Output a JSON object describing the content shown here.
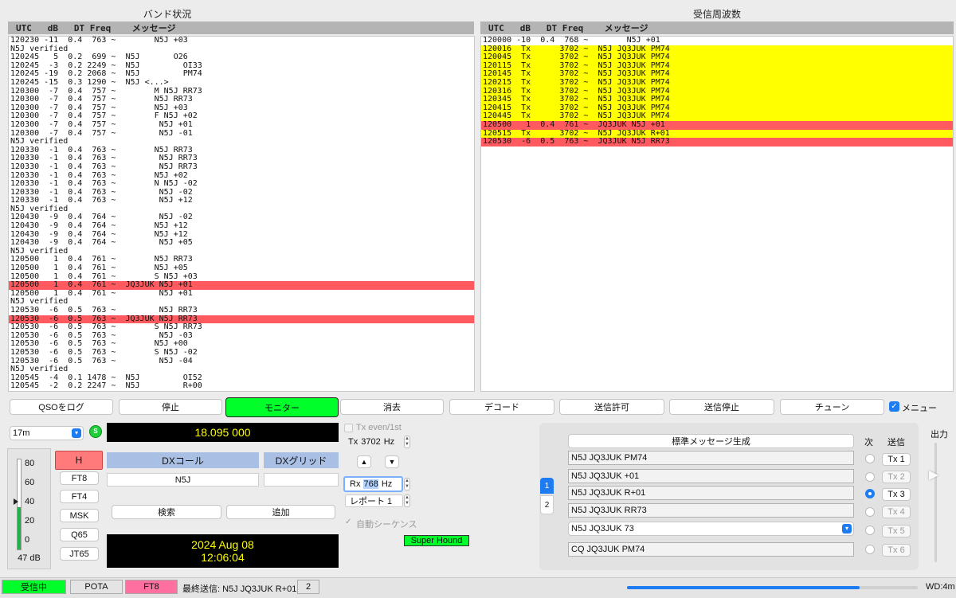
{
  "band_panel": {
    "title": "バンド状況",
    "header": "UTC   dB   DT Freq    メッセージ",
    "lines": [
      {
        "text": "120230 -11  0.4  763 ~        N5J +03",
        "hl": ""
      },
      {
        "text": "N5J verified",
        "hl": ""
      },
      {
        "text": "120245   5  0.2  699 ~  N5J       O26",
        "hl": ""
      },
      {
        "text": "120245  -3  0.2 2249 ~  N5J         OI33",
        "hl": ""
      },
      {
        "text": "120245 -19  0.2 2068 ~  N5J         PM74",
        "hl": ""
      },
      {
        "text": "120245 -15  0.3 1290 ~  N5J <...>",
        "hl": ""
      },
      {
        "text": "120300  -7  0.4  757 ~        M N5J RR73",
        "hl": ""
      },
      {
        "text": "120300  -7  0.4  757 ~        N5J RR73",
        "hl": ""
      },
      {
        "text": "120300  -7  0.4  757 ~        N5J +03",
        "hl": ""
      },
      {
        "text": "120300  -7  0.4  757 ~        F N5J +02",
        "hl": ""
      },
      {
        "text": "120300  -7  0.4  757 ~         N5J +01",
        "hl": ""
      },
      {
        "text": "120300  -7  0.4  757 ~         N5J -01",
        "hl": ""
      },
      {
        "text": "N5J verified",
        "hl": ""
      },
      {
        "text": "120330  -1  0.4  763 ~        N5J RR73",
        "hl": ""
      },
      {
        "text": "120330  -1  0.4  763 ~         N5J RR73",
        "hl": ""
      },
      {
        "text": "120330  -1  0.4  763 ~         N5J RR73",
        "hl": ""
      },
      {
        "text": "120330  -1  0.4  763 ~        N5J +02",
        "hl": ""
      },
      {
        "text": "120330  -1  0.4  763 ~        N N5J -02",
        "hl": ""
      },
      {
        "text": "120330  -1  0.4  763 ~         N5J -02",
        "hl": ""
      },
      {
        "text": "120330  -1  0.4  763 ~         N5J +12",
        "hl": ""
      },
      {
        "text": "N5J verified",
        "hl": ""
      },
      {
        "text": "120430  -9  0.4  764 ~         N5J -02",
        "hl": ""
      },
      {
        "text": "120430  -9  0.4  764 ~        N5J +12",
        "hl": ""
      },
      {
        "text": "120430  -9  0.4  764 ~        N5J +12",
        "hl": ""
      },
      {
        "text": "120430  -9  0.4  764 ~         N5J +05",
        "hl": ""
      },
      {
        "text": "N5J verified",
        "hl": ""
      },
      {
        "text": "120500   1  0.4  761 ~        N5J RR73",
        "hl": ""
      },
      {
        "text": "120500   1  0.4  761 ~        N5J +05",
        "hl": ""
      },
      {
        "text": "120500   1  0.4  761 ~        S N5J +03",
        "hl": ""
      },
      {
        "text": "120500   1  0.4  761 ~  JQ3JUK N5J +01",
        "hl": "red"
      },
      {
        "text": "120500   1  0.4  761 ~         N5J +01",
        "hl": ""
      },
      {
        "text": "N5J verified",
        "hl": ""
      },
      {
        "text": "120530  -6  0.5  763 ~         N5J RR73",
        "hl": ""
      },
      {
        "text": "120530  -6  0.5  763 ~  JQ3JUK N5J RR73",
        "hl": "red"
      },
      {
        "text": "120530  -6  0.5  763 ~        S N5J RR73",
        "hl": ""
      },
      {
        "text": "120530  -6  0.5  763 ~         N5J -03",
        "hl": ""
      },
      {
        "text": "120530  -6  0.5  763 ~        N5J +00",
        "hl": ""
      },
      {
        "text": "120530  -6  0.5  763 ~        S N5J -02",
        "hl": ""
      },
      {
        "text": "120530  -6  0.5  763 ~         N5J -04",
        "hl": ""
      },
      {
        "text": "N5J verified",
        "hl": ""
      },
      {
        "text": "120545  -4  0.1 1478 ~  N5J         OI52",
        "hl": ""
      },
      {
        "text": "120545  -2  0.2 2247 ~  N5J         R+00",
        "hl": ""
      }
    ]
  },
  "rx_panel": {
    "title": "受信周波数",
    "header": "UTC   dB   DT Freq    メッセージ",
    "lines": [
      {
        "text": "120000 -10  0.4  768 ~        N5J +01",
        "hl": ""
      },
      {
        "text": "120016  Tx      3702 ~  N5J JQ3JUK PM74",
        "hl": "yellow"
      },
      {
        "text": "120045  Tx      3702 ~  N5J JQ3JUK PM74",
        "hl": "yellow"
      },
      {
        "text": "120115  Tx      3702 ~  N5J JQ3JUK PM74",
        "hl": "yellow"
      },
      {
        "text": "120145  Tx      3702 ~  N5J JQ3JUK PM74",
        "hl": "yellow"
      },
      {
        "text": "120215  Tx      3702 ~  N5J JQ3JUK PM74",
        "hl": "yellow"
      },
      {
        "text": "120316  Tx      3702 ~  N5J JQ3JUK PM74",
        "hl": "yellow"
      },
      {
        "text": "120345  Tx      3702 ~  N5J JQ3JUK PM74",
        "hl": "yellow"
      },
      {
        "text": "120415  Tx      3702 ~  N5J JQ3JUK PM74",
        "hl": "yellow"
      },
      {
        "text": "120445  Tx      3702 ~  N5J JQ3JUK PM74",
        "hl": "yellow"
      },
      {
        "text": "120500   1  0.4  761 ~  JQ3JUK N5J +01",
        "hl": "red"
      },
      {
        "text": "120515  Tx      3702 ~  N5J JQ3JUK R+01",
        "hl": "yellow"
      },
      {
        "text": "120530  -6  0.5  763 ~  JQ3JUK N5J RR73",
        "hl": "red"
      }
    ]
  },
  "buttons": {
    "log_qso": "QSOをログ",
    "stop": "停止",
    "monitor": "モニター",
    "erase": "消去",
    "decode": "デコード",
    "enable_tx": "送信許可",
    "halt_tx": "送信停止",
    "tune": "チューン",
    "menu": "メニュー"
  },
  "controls": {
    "band": "17m",
    "s_label": "S",
    "frequency": "18.095 000",
    "h_button": "H",
    "modes": [
      "FT8",
      "FT4",
      "MSK",
      "Q65",
      "JT65"
    ],
    "meter_ticks": [
      "80",
      "60",
      "40",
      "20",
      "0"
    ],
    "meter_level": 0.47,
    "db_label": "47 dB",
    "dx_call_label": "DXコール",
    "dx_grid_label": "DXグリッド",
    "dx_call": "N5J",
    "dx_grid": "",
    "search": "検索",
    "add": "追加",
    "date": "2024 Aug 08",
    "time": "12:06:04",
    "tx_even": "Tx even/1st",
    "tx_freq_prefix": "Tx",
    "tx_freq": "3702",
    "hz": "Hz",
    "rx_prefix": "Rx",
    "rx_freq": "768",
    "report": "レポート 1",
    "auto_seq": "自動シーケンス",
    "super_hound": "Super Hound",
    "up_arrow": "▲",
    "down_arrow": "▼"
  },
  "messages": {
    "generate": "標準メッセージ生成",
    "next_label": "次",
    "send_label": "送信",
    "tab1": "1",
    "tab2": "2",
    "rows": [
      {
        "msg": "N5J JQ3JUK PM74",
        "btn": "Tx 1"
      },
      {
        "msg": "N5J JQ3JUK +01",
        "btn": "Tx 2"
      },
      {
        "msg": "N5J JQ3JUK R+01",
        "btn": "Tx 3"
      },
      {
        "msg": "N5J JQ3JUK RR73",
        "btn": "Tx 4"
      },
      {
        "msg": "N5J JQ3JUK 73",
        "btn": "Tx 5"
      },
      {
        "msg": "CQ JQ3JUK PM74",
        "btn": "Tx 6"
      }
    ],
    "power_label": "出力"
  },
  "status": {
    "receiving": "受信中",
    "pota": "POTA",
    "mode": "FT8",
    "last_tx": "最終送信: N5J JQ3JUK R+01",
    "count": "2",
    "progress": 0.8,
    "wd": "WD:4m"
  },
  "colors": {
    "green": "#00ff2a",
    "red_highlight": "#ff5a5f",
    "yellow_highlight": "#ffff00",
    "pink": "#ff6fa0",
    "accent": "#1d7cf2"
  }
}
